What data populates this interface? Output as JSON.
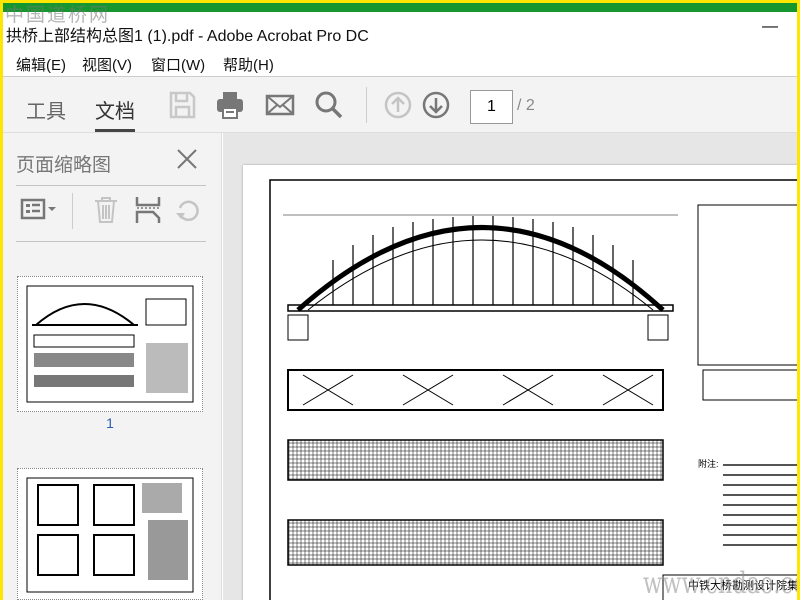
{
  "window": {
    "title": "拱桥上部结构总图1 (1).pdf - Adobe Acrobat Pro DC",
    "minimize": "—"
  },
  "watermark": {
    "top": "中国道桥网",
    "bottom": "www.cndao.com"
  },
  "menu": [
    "编辑(E)",
    "视图(V)",
    "窗口(W)",
    "帮助(H)"
  ],
  "toolbar": {
    "tabs": [
      "工具",
      "文档"
    ],
    "active_tab": "文档",
    "current_page": "1",
    "total_pages": "/ 2"
  },
  "panel": {
    "title": "页面缩略图",
    "thumbnail_label": "1"
  },
  "drawing": {
    "company": "中铁大桥勘测设计院集团有",
    "note_label": "附注:"
  },
  "colors": {
    "accent_green": "#16962f",
    "frame_yellow": "#ffe600",
    "link_blue": "#2a5db0"
  }
}
